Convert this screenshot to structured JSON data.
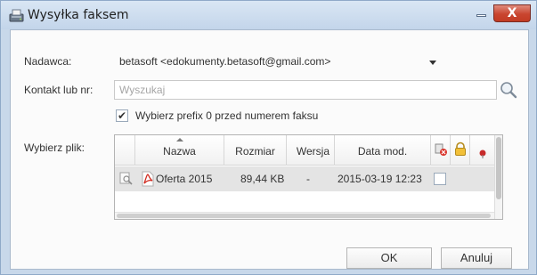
{
  "window": {
    "title": "Wysyłka faksem",
    "close_label": "X"
  },
  "form": {
    "sender_label": "Nadawca:",
    "sender_value": "betasoft <edokumenty.betasoft@gmail.com>",
    "contact_label": "Kontakt lub nr:",
    "search_placeholder": "Wyszukaj",
    "prefix_checkbox_label": "Wybierz prefix 0 przed numerem faksu",
    "prefix_checked": true,
    "file_label": "Wybierz plik:"
  },
  "grid": {
    "columns": [
      "Nazwa",
      "Rozmiar",
      "Wersja",
      "Data mod."
    ],
    "rows": [
      {
        "name": "Oferta 2015",
        "size": "89,44 KB",
        "version": "-",
        "modified": "2015-03-19 12:23",
        "selected": false
      }
    ]
  },
  "buttons": {
    "ok": "OK",
    "cancel": "Anuluj"
  }
}
